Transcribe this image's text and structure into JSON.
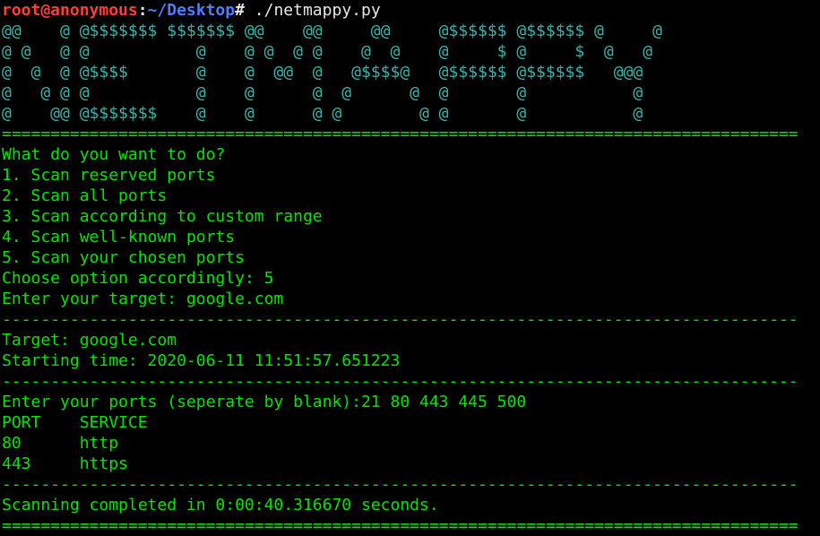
{
  "colors": {
    "background": "#000000",
    "banner": "#38b6ad",
    "output": "#00e600",
    "prompt_user": "#ff3b3b",
    "prompt_path": "#4f7bff",
    "command": "#e6e6e6"
  },
  "prompt": {
    "user_host": "root@anonymous",
    "separator": ":",
    "path": "~/Desktop",
    "symbol": "#",
    "command": " ./netmappy.py"
  },
  "banner": [
    "@@    @ @$$$$$$$ $$$$$$$ @@    @@     @@     @$$$$$$ @$$$$$$ @     @",
    "@ @   @ @           @    @ @  @ @    @  @    @     $ @     $  @   @",
    "@  @  @ @$$$$       @    @  @@  @   @$$$$@   @$$$$$$ @$$$$$$   @@@",
    "@   @ @ @           @    @      @  @      @  @       @           @",
    "@    @@ @$$$$$$$    @    @      @ @        @ @       @           @"
  ],
  "lines": [
    "==================================================================================",
    "What do you want to do?",
    "1. Scan reserved ports",
    "2. Scan all ports",
    "3. Scan according to custom range",
    "4. Scan well-known ports",
    "5. Scan your chosen ports",
    "Choose option accordingly: 5",
    "Enter your target: google.com",
    "----------------------------------------------------------------------------------",
    "Target: google.com",
    "Starting time: 2020-06-11 11:51:57.651223",
    "----------------------------------------------------------------------------------",
    "Enter your ports (seperate by blank):21 80 443 445 500",
    "PORT    SERVICE",
    "80      http",
    "443     https",
    "----------------------------------------------------------------------------------",
    "Scanning completed in 0:00:40.316670 seconds.",
    "=================================================================================="
  ]
}
